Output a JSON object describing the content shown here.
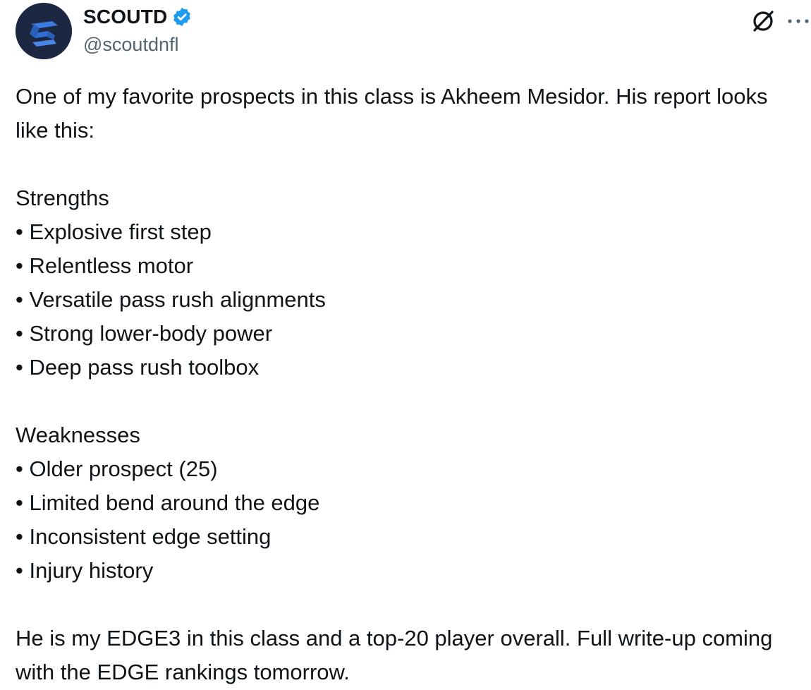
{
  "author": {
    "display_name": "SCOUTD",
    "handle": "@scoutdnfl",
    "avatar_icon": "scoutd-logo",
    "verified_icon": "verified-badge-icon",
    "verified_color": "#1d9bf0"
  },
  "actions": {
    "grok_icon": "grok-icon",
    "more_icon": "more-icon",
    "more_glyph": "···"
  },
  "tweet": {
    "intro": "One of my favorite prospects in this class is Akheem Mesidor. His report looks like this:",
    "strengths_heading": "Strengths",
    "strengths": [
      "• Explosive first step",
      "• Relentless motor",
      "• Versatile pass rush alignments",
      "• Strong lower-body power",
      "• Deep pass rush toolbox"
    ],
    "weaknesses_heading": "Weaknesses",
    "weaknesses": [
      "• Older prospect (25)",
      "• Limited bend around the edge",
      "• Inconsistent edge setting",
      "• Injury history"
    ],
    "closing": "He is my EDGE3 in this class and a top-20 player overall. Full write-up coming with the EDGE rankings tomorrow."
  },
  "colors": {
    "text": "#0f1419",
    "secondary_text": "#536471",
    "avatar_bg": "#1c2742",
    "avatar_accent": "#2f6fd6"
  }
}
